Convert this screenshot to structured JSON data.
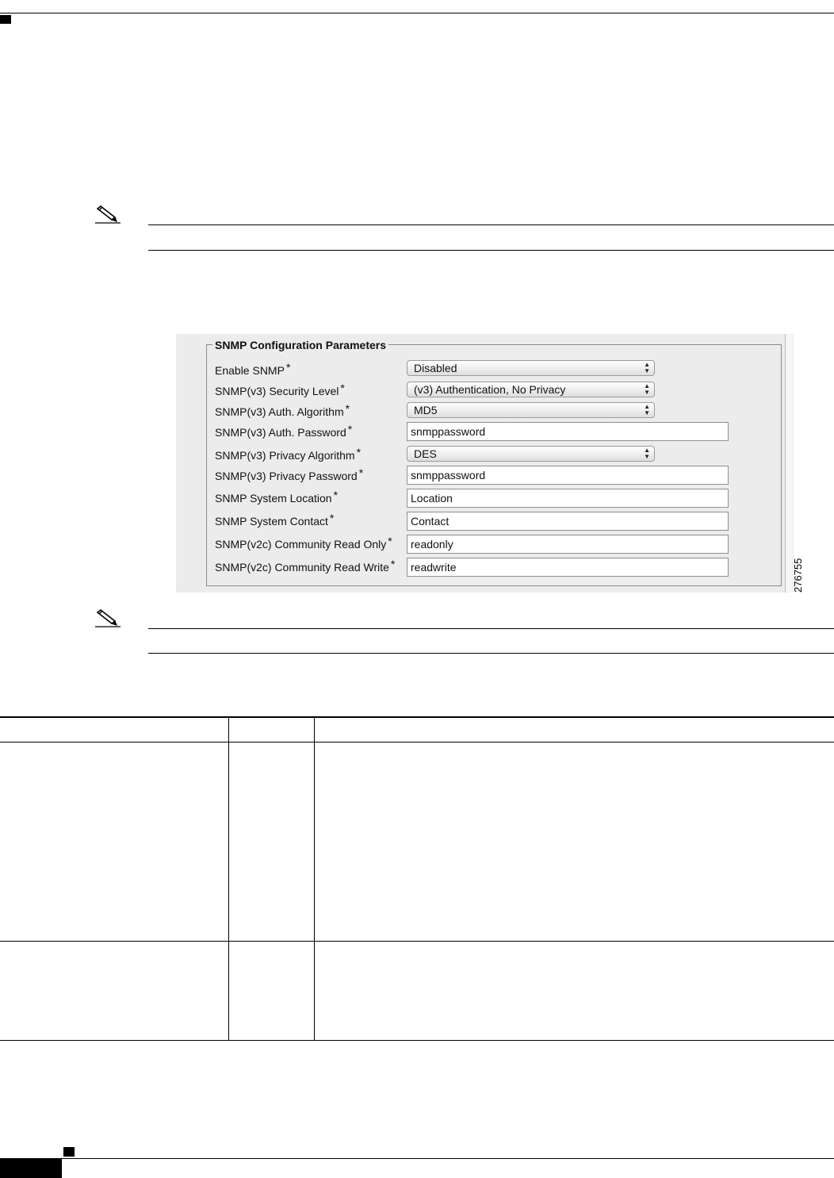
{
  "figure": {
    "legend": "SNMP Configuration Parameters",
    "figure_number": "276755",
    "fields": [
      {
        "label": "Enable SNMP",
        "kind": "select",
        "value": "Disabled"
      },
      {
        "label": "SNMP(v3) Security Level",
        "kind": "select",
        "value": "(v3) Authentication, No Privacy"
      },
      {
        "label": "SNMP(v3) Auth. Algorithm",
        "kind": "select",
        "value": "MD5"
      },
      {
        "label": "SNMP(v3) Auth. Password",
        "kind": "input",
        "value": "snmppassword"
      },
      {
        "label": "SNMP(v3) Privacy Algorithm",
        "kind": "select",
        "value": "DES"
      },
      {
        "label": "SNMP(v3) Privacy Password",
        "kind": "input",
        "value": "snmppassword"
      },
      {
        "label": "SNMP System Location",
        "kind": "input",
        "value": "Location"
      },
      {
        "label": "SNMP System Contact",
        "kind": "input",
        "value": "Contact"
      },
      {
        "label": "SNMP(v2c) Community Read Only",
        "kind": "input",
        "value": "readonly"
      },
      {
        "label": "SNMP(v2c) Community Read Write",
        "kind": "input",
        "value": "readwrite"
      }
    ],
    "required_marker": "*"
  },
  "icons": {
    "note": "pencil-note-icon",
    "select_arrows": "up-down-arrows-icon"
  }
}
